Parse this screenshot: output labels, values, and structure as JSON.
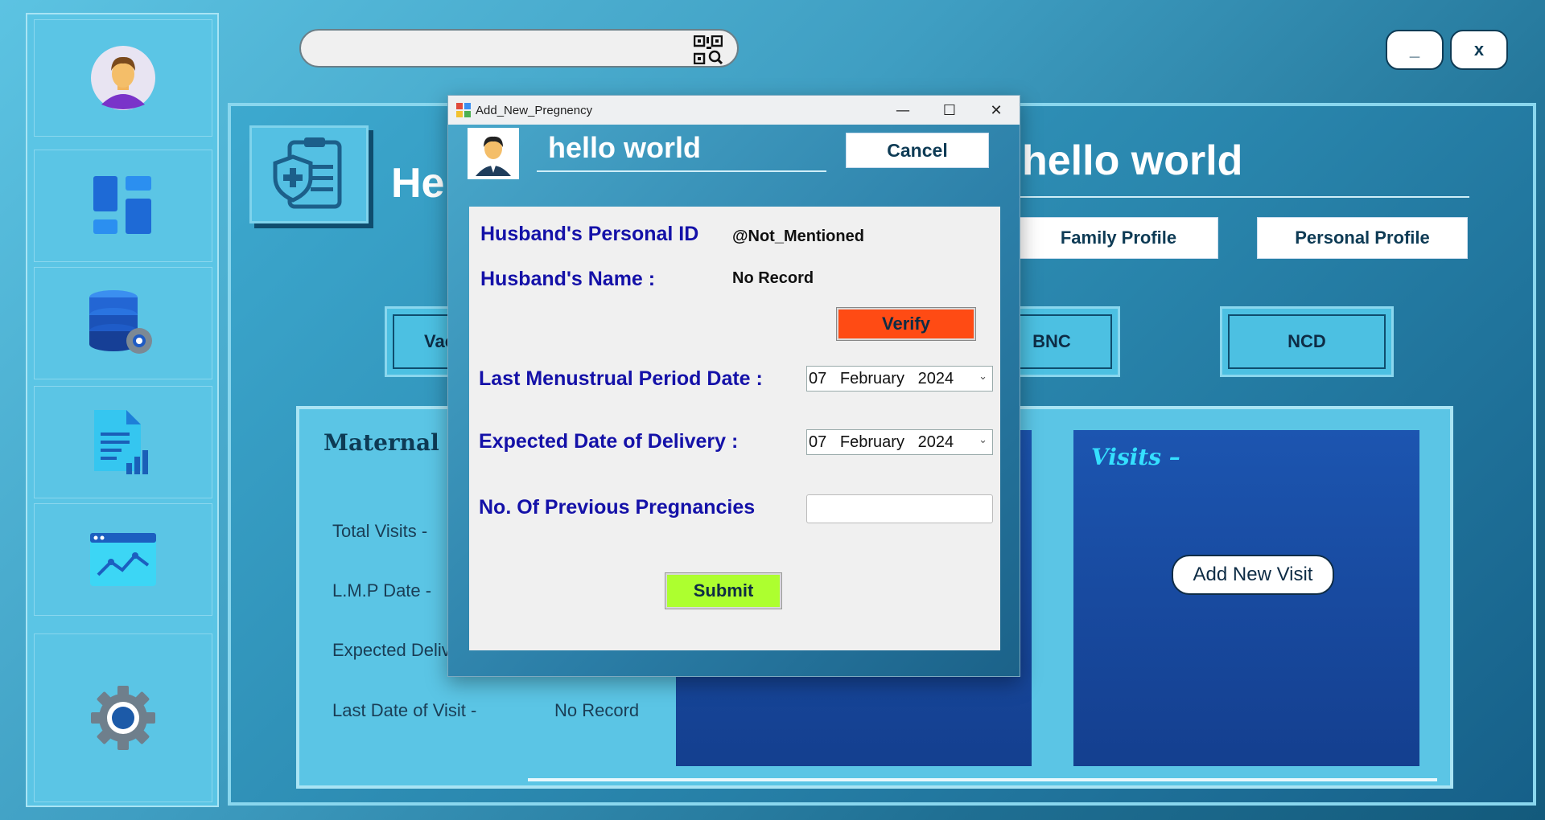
{
  "window": {
    "minimize_label": "_",
    "close_label": "x"
  },
  "sidebar": {
    "items": [
      {
        "icon": "user-avatar-icon"
      },
      {
        "icon": "dashboard-icon"
      },
      {
        "icon": "database-settings-icon"
      },
      {
        "icon": "report-document-icon"
      },
      {
        "icon": "analytics-chart-icon"
      },
      {
        "icon": "gear-icon"
      }
    ]
  },
  "search": {
    "placeholder": "",
    "icon": "qr-scan-icon"
  },
  "main": {
    "title_partial": "He",
    "title_right": "hello world",
    "profile_buttons": [
      "Family Profile",
      "Personal Profile"
    ],
    "program_buttons": [
      "Vac",
      "BNC",
      "NCD"
    ],
    "panel_title": "Maternal Hea",
    "info_rows": [
      {
        "label": "Total Visits -",
        "value": ""
      },
      {
        "label": "L.M.P Date -",
        "value": ""
      },
      {
        "label": "Expected Deliv",
        "value": ""
      },
      {
        "label": "Last Date of Visit -",
        "value": "No Record"
      }
    ],
    "visits_title": "Visits –",
    "add_visit_label": "Add New Visit"
  },
  "dialog": {
    "title": "Add_New_Pregnency",
    "controls": {
      "minimize": "—",
      "maximize": "☐",
      "close": "✕"
    },
    "user_name": "hello world",
    "cancel_label": "Cancel",
    "husband_id_label": "Husband's Personal ID",
    "husband_id_value": "@Not_Mentioned",
    "husband_name_label": "Husband's Name :",
    "husband_name_value": "No Record",
    "verify_label": "Verify",
    "lmp_label": "Last Menustrual Period Date :",
    "lmp_value": "07   February   2024",
    "edd_label": "Expected Date of Delivery :",
    "edd_value": "07   February   2024",
    "prev_preg_label": "No. Of Previous Pregnancies",
    "prev_preg_value": "",
    "submit_label": "Submit"
  },
  "colors": {
    "verify_bg": "#ff4b14",
    "submit_bg": "#adff2f",
    "label_blue": "#1411a8",
    "visits_title": "#35e0ff"
  }
}
